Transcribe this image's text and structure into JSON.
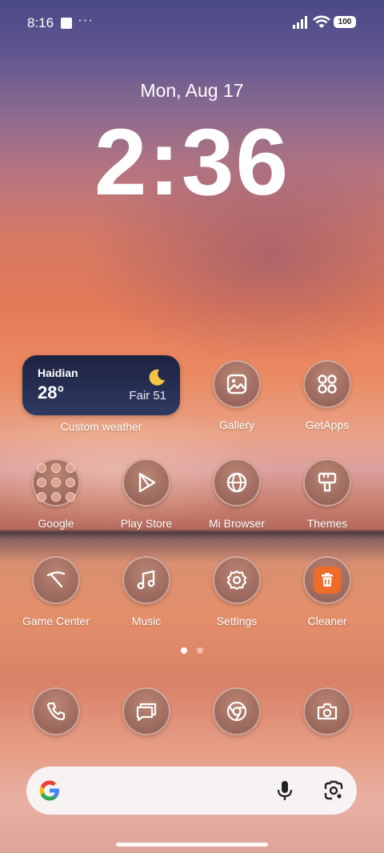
{
  "status_bar": {
    "time": "8:16",
    "more": "···",
    "battery": "100"
  },
  "lock": {
    "date": "Mon, Aug 17",
    "time": "2:36"
  },
  "weather": {
    "city": "Haidian",
    "temp": "28°",
    "desc": "Fair 51",
    "label": "Custom weather"
  },
  "apps": {
    "gallery": "Gallery",
    "getapps": "GetApps",
    "google": "Google",
    "play_store": "Play Store",
    "mi_browser": "Mi Browser",
    "themes": "Themes",
    "game_center": "Game Center",
    "music": "Music",
    "settings": "Settings",
    "cleaner": "Cleaner"
  },
  "dock": [
    "phone",
    "messages",
    "chrome",
    "camera"
  ],
  "icons": {
    "signal": "signal-icon",
    "wifi": "wifi-icon",
    "battery": "battery-icon",
    "moon": "moon-icon",
    "mic": "mic-icon",
    "lens": "google-lens-icon"
  },
  "colors": {
    "weather_widget": "#1c2240",
    "cleaner_accent": "#ef6b2a",
    "search_bar": "#f7f3f3"
  },
  "pager": {
    "pages": 2,
    "current": 1
  }
}
